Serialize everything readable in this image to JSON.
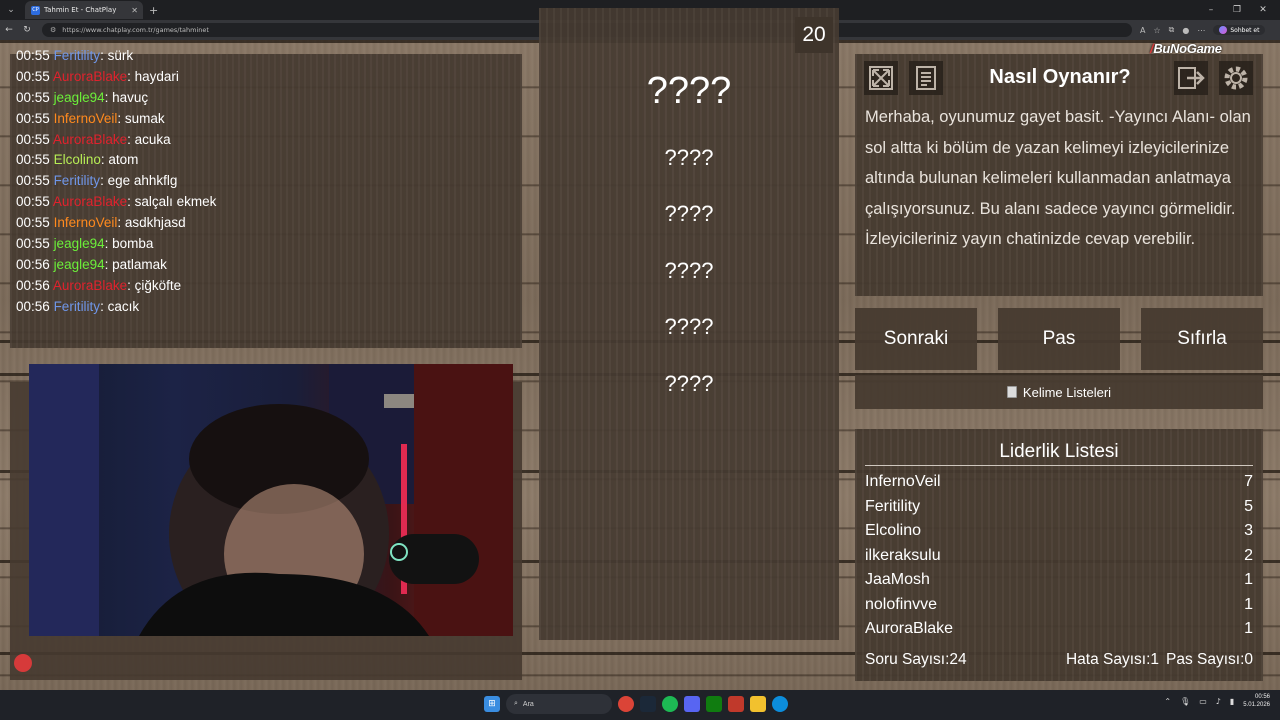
{
  "browser": {
    "tab_title": "Tahmin Et - ChatPlay",
    "tab_favicon": "CP",
    "url": "https://www.chatplay.com.tr/games/tahminet",
    "chat_button": "Sohbet et"
  },
  "chat": {
    "messages": [
      {
        "time": "00:55",
        "user": "Feritility",
        "color": "#6f96e8",
        "text": ": sürk"
      },
      {
        "time": "00:55",
        "user": "AuroraBlake",
        "color": "#e0222d",
        "text": ": haydari"
      },
      {
        "time": "00:55",
        "user": "jeagle94",
        "color": "#6cf03a",
        "text": ": havuç"
      },
      {
        "time": "00:55",
        "user": "InfernoVeil",
        "color": "#ff8a1e",
        "text": ": sumak"
      },
      {
        "time": "00:55",
        "user": "AuroraBlake",
        "color": "#e0222d",
        "text": ": acuka"
      },
      {
        "time": "00:55",
        "user": "Elcolino",
        "color": "#b6ec55",
        "text": ": atom"
      },
      {
        "time": "00:55",
        "user": "Feritility",
        "color": "#6f96e8",
        "text": ": ege ahhkflg"
      },
      {
        "time": "00:55",
        "user": "AuroraBlake",
        "color": "#e0222d",
        "text": ": salçalı ekmek"
      },
      {
        "time": "00:55",
        "user": "InfernoVeil",
        "color": "#ff8a1e",
        "text": ": asdkhjasd"
      },
      {
        "time": "00:55",
        "user": "jeagle94",
        "color": "#6cf03a",
        "text": ": bomba"
      },
      {
        "time": "00:56",
        "user": "jeagle94",
        "color": "#6cf03a",
        "text": ": patlamak"
      },
      {
        "time": "00:56",
        "user": "AuroraBlake",
        "color": "#e0222d",
        "text": ": çiğköfte"
      },
      {
        "time": "00:56",
        "user": "Feritility",
        "color": "#6f96e8",
        "text": ": cacık"
      }
    ]
  },
  "game": {
    "timer": "20",
    "main_word": "????",
    "forbidden_words": [
      "????",
      "????",
      "????",
      "????",
      "????"
    ]
  },
  "help": {
    "title": "Nasıl Oynanır?",
    "brand": "BuNoGame",
    "text": "Merhaba, oyunumuz gayet basit. -Yayıncı Alanı- olan sol altta ki bölüm de yazan kelimeyi izleyicilerinize altında bulunan kelimeleri kullanmadan anlatmaya çalışıyorsunuz. Bu alanı sadece yayıncı görmelidir. İzleyicileriniz yayın chatinizde cevap verebilir.",
    "icons": [
      "fullscreen-icon",
      "notes-icon",
      "exit-icon",
      "settings-icon"
    ]
  },
  "actions": {
    "next": "Sonraki",
    "pass": "Pas",
    "reset": "Sıfırla",
    "word_lists": "Kelime Listeleri"
  },
  "leaderboard": {
    "title": "Liderlik Listesi",
    "rows": [
      {
        "name": "InfernoVeil",
        "score": "7"
      },
      {
        "name": "Feritility",
        "score": "5"
      },
      {
        "name": "Elcolino",
        "score": "3"
      },
      {
        "name": "ilkeraksulu",
        "score": "2"
      },
      {
        "name": "JaaMosh",
        "score": "1"
      },
      {
        "name": "nolofinvve",
        "score": "1"
      },
      {
        "name": "AuroraBlake",
        "score": "1"
      }
    ],
    "question_count": "Soru Sayısı:24",
    "error_count": "Hata Sayısı:1",
    "pass_count": "Pas Sayısı:0"
  },
  "taskbar": {
    "search_placeholder": "Ara",
    "time": "00:56",
    "date": "5.01.2026"
  }
}
